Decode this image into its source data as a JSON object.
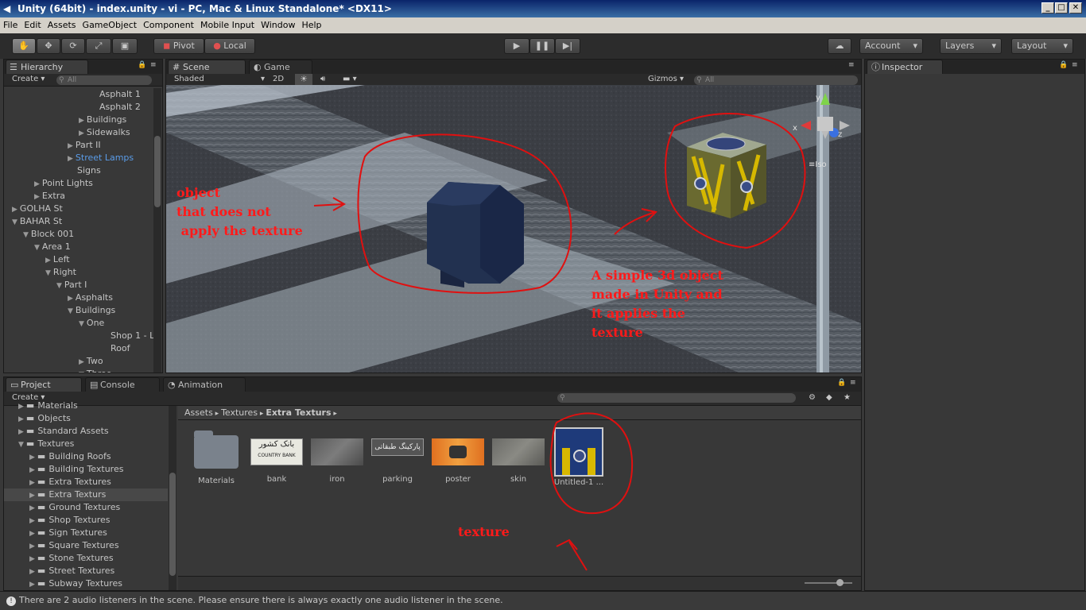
{
  "window": {
    "title": "Unity (64bit) - index.unity - vi - PC, Mac & Linux Standalone* <DX11>"
  },
  "menu": [
    "File",
    "Edit",
    "Assets",
    "GameObject",
    "Component",
    "Mobile Input",
    "Window",
    "Help"
  ],
  "toolbar": {
    "pivot": "Pivot",
    "local": "Local",
    "account": "Account",
    "layers": "Layers",
    "layout": "Layout"
  },
  "hierarchy": {
    "tab": "Hierarchy",
    "create": "Create",
    "search_placeholder": "All",
    "rows": [
      {
        "label": "Asphalt 1",
        "indent": 8,
        "arrow": ""
      },
      {
        "label": "Asphalt 2",
        "indent": 8,
        "arrow": ""
      },
      {
        "label": "Buildings",
        "indent": 7,
        "arrow": "▶"
      },
      {
        "label": "Sidewalks",
        "indent": 7,
        "arrow": "▶"
      },
      {
        "label": "Part II",
        "indent": 6,
        "arrow": "▶"
      },
      {
        "label": "Street Lamps",
        "indent": 6,
        "arrow": "▶",
        "highlight": true
      },
      {
        "label": "Signs",
        "indent": 6,
        "arrow": ""
      },
      {
        "label": "Point Lights",
        "indent": 3,
        "arrow": "▶"
      },
      {
        "label": "Extra",
        "indent": 3,
        "arrow": "▶"
      },
      {
        "label": "GOLHA St",
        "indent": 1,
        "arrow": "▶"
      },
      {
        "label": "BAHAR St",
        "indent": 1,
        "arrow": "▼"
      },
      {
        "label": "Block 001",
        "indent": 2,
        "arrow": "▼"
      },
      {
        "label": "Area 1",
        "indent": 3,
        "arrow": "▼"
      },
      {
        "label": "Left",
        "indent": 4,
        "arrow": "▶"
      },
      {
        "label": "Right",
        "indent": 4,
        "arrow": "▼"
      },
      {
        "label": "Part I",
        "indent": 5,
        "arrow": "▼"
      },
      {
        "label": "Asphalts",
        "indent": 6,
        "arrow": "▶"
      },
      {
        "label": "Buildings",
        "indent": 6,
        "arrow": "▼"
      },
      {
        "label": "One",
        "indent": 7,
        "arrow": "▼"
      },
      {
        "label": "Shop 1 - L",
        "indent": 9,
        "arrow": ""
      },
      {
        "label": "Roof",
        "indent": 9,
        "arrow": ""
      },
      {
        "label": "Two",
        "indent": 7,
        "arrow": "▶"
      },
      {
        "label": "Three",
        "indent": 7,
        "arrow": "▼"
      }
    ]
  },
  "scene": {
    "tab_scene": "Scene",
    "tab_game": "Game",
    "shading": "Shaded",
    "mode_2d": "2D",
    "gizmos": "Gizmos",
    "search_placeholder": "All",
    "gizmo_axes": {
      "x": "x",
      "y": "y",
      "z": "z"
    },
    "iso": "Iso"
  },
  "inspector": {
    "tab": "Inspector"
  },
  "project": {
    "tab_project": "Project",
    "tab_console": "Console",
    "tab_animation": "Animation",
    "create": "Create",
    "folders": [
      {
        "label": "Materials",
        "indent": 2
      },
      {
        "label": "Objects",
        "indent": 2
      },
      {
        "label": "Standard Assets",
        "indent": 2
      },
      {
        "label": "Textures",
        "indent": 2,
        "open": true
      },
      {
        "label": "Building Roofs",
        "indent": 3
      },
      {
        "label": "Building Textures",
        "indent": 3
      },
      {
        "label": "Extra Textures",
        "indent": 3
      },
      {
        "label": "Extra Texturs",
        "indent": 3,
        "selected": true
      },
      {
        "label": "Ground Textures",
        "indent": 3
      },
      {
        "label": "Shop Textures",
        "indent": 3
      },
      {
        "label": "Sign Textures",
        "indent": 3
      },
      {
        "label": "Square Textures",
        "indent": 3
      },
      {
        "label": "Stone Textures",
        "indent": 3
      },
      {
        "label": "Street Textures",
        "indent": 3
      },
      {
        "label": "Subway Textures",
        "indent": 3
      }
    ],
    "breadcrumb": [
      "Assets",
      "Textures",
      "Extra Texturs"
    ],
    "assets": [
      {
        "label": "Materials",
        "kind": "folder"
      },
      {
        "label": "bank",
        "kind": "bank",
        "text1": "بانک کشور",
        "text2": "COUNTRY BANK"
      },
      {
        "label": "iron",
        "kind": "iron"
      },
      {
        "label": "parking",
        "kind": "parking",
        "text1": "پارکینگ طبقاتی"
      },
      {
        "label": "poster",
        "kind": "poster"
      },
      {
        "label": "skin",
        "kind": "skin"
      },
      {
        "label": "Untitled-1 ...",
        "kind": "untitled"
      }
    ]
  },
  "annotations": {
    "left": "object\nthat does not\n apply the texture",
    "right": "A simple 3d object\nmade in Unity and\nit applies the\ntexture",
    "texture": "texture"
  },
  "status": {
    "message": "There are 2 audio listeners in the scene. Please ensure there is always exactly one audio listener in the scene."
  }
}
